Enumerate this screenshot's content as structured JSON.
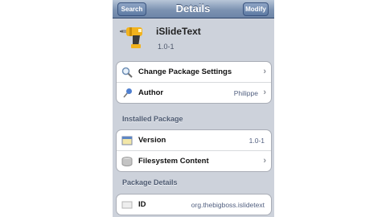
{
  "nav": {
    "back_label": "Search",
    "title": "Details",
    "modify_label": "Modify"
  },
  "package": {
    "name": "iSlideText",
    "version": "1.0-1",
    "icon": "drill-icon"
  },
  "group1": {
    "change_settings_label": "Change Package Settings",
    "author_label": "Author",
    "author_value": "Philippe"
  },
  "installed": {
    "header": "Installed Package",
    "version_label": "Version",
    "version_value": "1.0-1",
    "filesystem_label": "Filesystem Content"
  },
  "details": {
    "header": "Package Details",
    "id_label": "ID",
    "id_value": "org.thebigboss.islidetext"
  },
  "colors": {
    "navbar": "#7d93b2",
    "background": "#cdd2db",
    "value_text": "#526080"
  }
}
